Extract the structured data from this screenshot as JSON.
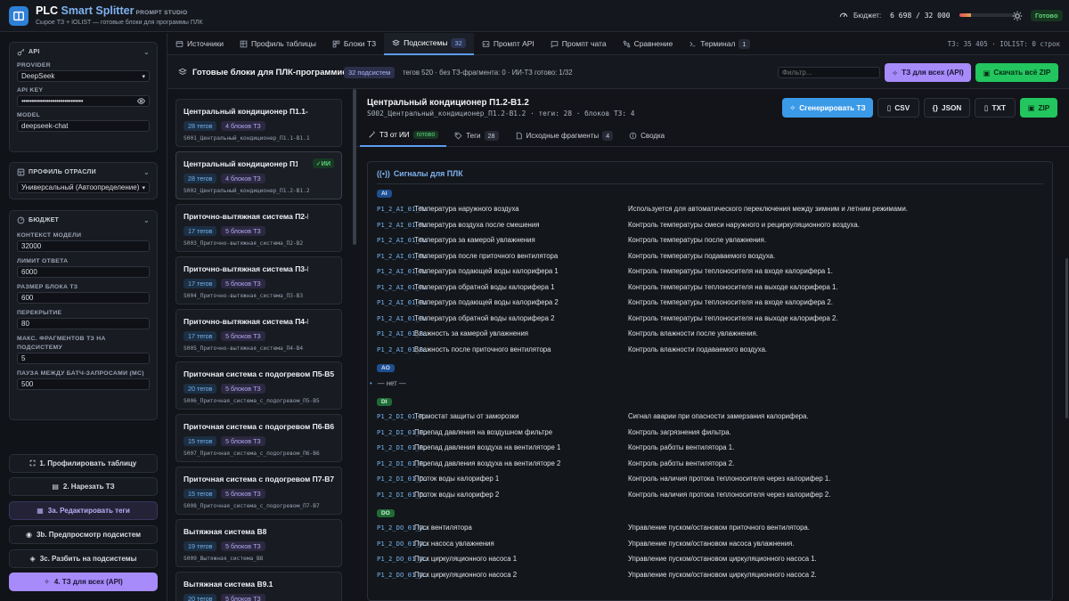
{
  "app": {
    "title_part1": "PLC ",
    "title_part2": "Smart Splitter",
    "studio": "PROMPT STUDIO",
    "subtitle": "Сырое ТЗ + IOLIST — готовые блоки для программы ПЛК",
    "budget_label": "Бюджет:",
    "budget_value": "6 698 / 32 000",
    "budget_fraction": 0.209,
    "status": "Готово"
  },
  "sidebar": {
    "api": {
      "header": "API",
      "provider_label": "PROVIDER",
      "provider_value": "DeepSeek",
      "apikey_label": "API KEY",
      "apikey_value": "••••••••••••••••••••••••••••••",
      "model_label": "MODEL",
      "model_value": "deepseek-chat"
    },
    "industry": {
      "header": "ПРОФИЛЬ ОТРАСЛИ",
      "value": "Универсальный (Автоопределение)"
    },
    "budget": {
      "header": "БЮДЖЕТ",
      "fields": [
        {
          "label": "КОНТЕКСТ МОДЕЛИ",
          "value": "32000"
        },
        {
          "label": "ЛИМИТ ОТВЕТА",
          "value": "6000"
        },
        {
          "label": "РАЗМЕР БЛОКА ТЗ",
          "value": "600"
        },
        {
          "label": "ПЕРЕКРЫТИЕ",
          "value": "80"
        },
        {
          "label": "МАКС. ФРАГМЕНТОВ ТЗ НА",
          "label2": "ПОДСИСТЕМУ",
          "value": "5"
        },
        {
          "label": "ПАУЗА МЕЖДУ БАТЧ-ЗАПРОСАМИ (МС)",
          "value": "500"
        }
      ]
    },
    "buttons": [
      {
        "label": "1. Профилировать таблицу",
        "icon": "scan-icon"
      },
      {
        "label": "2. Нарезать ТЗ",
        "icon": "table-icon"
      },
      {
        "label": "3a. Редактировать теги",
        "icon": "edit-table-icon"
      },
      {
        "label": "3b. Предпросмотр подсистем",
        "icon": "eye-icon"
      },
      {
        "label": "3c. Разбить на подсистемы",
        "icon": "layers-icon"
      },
      {
        "label": "4. ТЗ для всех (API)",
        "icon": "sparkle-icon"
      }
    ]
  },
  "tabs": [
    {
      "label": "Источники",
      "icon": "folder-icon"
    },
    {
      "label": "Профиль таблицы",
      "icon": "grid-icon"
    },
    {
      "label": "Блоки ТЗ",
      "icon": "blocks-icon"
    },
    {
      "label": "Подсистемы",
      "icon": "layers-icon",
      "count": "32"
    },
    {
      "label": "Промпт API",
      "icon": "code-icon"
    },
    {
      "label": "Промпт чата",
      "icon": "chat-icon"
    },
    {
      "label": "Сравнение",
      "icon": "compare-icon"
    },
    {
      "label": "Терминал",
      "icon": "terminal-icon",
      "count": "1"
    }
  ],
  "tabs_right": "ТЗ: 35 405 · IOLIST: 0 строк",
  "header": {
    "title": "Готовые блоки для ПЛК-программиста",
    "badge": "32 подсистем",
    "meta": "тегов 520 · без ТЗ-фрагмента: 0 · ИИ-ТЗ готово: 1/32",
    "filter_placeholder": "Фильтр...",
    "btn_api": "ТЗ для всех (API)",
    "btn_zip": "Скачать всё ZIP"
  },
  "subsystems": [
    {
      "name": "Центральный кондиционер П1.1-В1.1",
      "tags": "28 тегов",
      "blocks": "4 блоков ТЗ",
      "file": "S001_Центральный_кондиционер_П1.1-В1.1"
    },
    {
      "name": "Центральный кондиционер П1.2-В1.2",
      "ai": "✓ИИ",
      "tags": "28 тегов",
      "blocks": "4 блоков ТЗ",
      "file": "S002_Центральный_кондиционер_П1.2-В1.2"
    },
    {
      "name": "Приточно-вытяжная система П2-В2",
      "tags": "17 тегов",
      "blocks": "5 блоков ТЗ",
      "file": "S003_Приточно-вытяжная_система_П2-В2"
    },
    {
      "name": "Приточно-вытяжная система П3-В3",
      "tags": "17 тегов",
      "blocks": "5 блоков ТЗ",
      "file": "S004_Приточно-вытяжная_система_П3-В3"
    },
    {
      "name": "Приточно-вытяжная система П4-В4",
      "tags": "17 тегов",
      "blocks": "5 блоков ТЗ",
      "file": "S005_Приточно-вытяжная_система_П4-В4"
    },
    {
      "name": "Приточная система с подогревом П5-В5",
      "tags": "20 тегов",
      "blocks": "5 блоков ТЗ",
      "file": "S006_Приточная_система_с_подогревом_П5-В5"
    },
    {
      "name": "Приточная система с подогревом П6-В6",
      "tags": "15 тегов",
      "blocks": "5 блоков ТЗ",
      "file": "S007_Приточная_система_с_подогревом_П6-В6"
    },
    {
      "name": "Приточная система с подогревом П7-В7",
      "tags": "15 тегов",
      "blocks": "5 блоков ТЗ",
      "file": "S008_Приточная_система_с_подогревом_П7-В7"
    },
    {
      "name": "Вытяжная система В8",
      "tags": "19 тегов",
      "blocks": "5 блоков ТЗ",
      "file": "S009_Вытяжная_система_В8"
    },
    {
      "name": "Вытяжная система В9.1",
      "tags": "20 тегов",
      "blocks": "5 блоков ТЗ",
      "file": ""
    }
  ],
  "detail": {
    "title": "Центральный кондиционер П1.2-В1.2",
    "sub": "S002_Центральный_кондиционер_П1.2-В1.2 · теги: 28 · блоков ТЗ: 4",
    "btn_generate": "Сгенерировать ТЗ",
    "btn_csv": "CSV",
    "btn_json": "JSON",
    "btn_txt": "TXT",
    "btn_zip": "ZIP",
    "tabs": [
      {
        "label": "ТЗ от ИИ",
        "badge": "готово"
      },
      {
        "label": "Теги",
        "count": "28"
      },
      {
        "label": "Исходные фрагменты",
        "count": "4"
      },
      {
        "label": "Сводка"
      }
    ],
    "section_title": "Сигналы для ПЛК",
    "none_text": "— нет —",
    "groups": {
      "ai": "AI",
      "ao": "AO",
      "di": "DI",
      "do": "DO"
    },
    "ai_rows": [
      {
        "code": "P1_2_AI_01_T…",
        "sig": "Температура наружного воздуха",
        "desc": "Используется для автоматического переключения между зимним и летним режимами."
      },
      {
        "code": "P1_2_AI_01_T…",
        "sig": "Температура воздуха после смешения",
        "desc": "Контроль температуры смеси наружного и рециркуляционного воздуха."
      },
      {
        "code": "P1_2_AI_01_T…",
        "sig": "Температура за камерой увлажнения",
        "desc": "Контроль температуры после увлажнения."
      },
      {
        "code": "P1_2_AI_01_T…",
        "sig": "Температура после приточного вентилятора",
        "desc": "Контроль температуры подаваемого воздуха."
      },
      {
        "code": "P1_2_AI_01_T…",
        "sig": "Температура подающей воды калорифера 1",
        "desc": "Контроль температуры теплоносителя на входе калорифера 1."
      },
      {
        "code": "P1_2_AI_01_T…",
        "sig": "Температура обратной воды калорифера 1",
        "desc": "Контроль температуры теплоносителя на выходе калорифера 1."
      },
      {
        "code": "P1_2_AI_01_T…",
        "sig": "Температура подающей воды калорифера 2",
        "desc": "Контроль температуры теплоносителя на входе калорифера 2."
      },
      {
        "code": "P1_2_AI_01_T…",
        "sig": "Температура обратной воды калорифера 2",
        "desc": "Контроль температуры теплоносителя на выходе калорифера 2."
      },
      {
        "code": "P1_2_AI_01_B…",
        "sig": "Влажность за камерой увлажнения",
        "desc": "Контроль влажности после увлажнения."
      },
      {
        "code": "P1_2_AI_01_B…",
        "sig": "Влажность после приточного вентилятора",
        "desc": "Контроль влажности подаваемого воздуха."
      }
    ],
    "di_rows": [
      {
        "code": "P1_2_DI_01_T…",
        "sig": "Термостат защиты от заморозки",
        "desc": "Сигнал аварии при опасности замерзания калорифера."
      },
      {
        "code": "P1_2_DI_01_П…",
        "sig": "Перепад давления на воздушном фильтре",
        "desc": "Контроль загрязнения фильтра."
      },
      {
        "code": "P1_2_DI_01_П…",
        "sig": "Перепад давления воздуха на вентиляторе 1",
        "desc": "Контроль работы вентилятора 1."
      },
      {
        "code": "P1_2_DI_01_П…",
        "sig": "Перепад давления воздуха на вентиляторе 2",
        "desc": "Контроль работы вентилятора 2."
      },
      {
        "code": "P1_2_DI_01_П…",
        "sig": "Проток воды калорифер 1",
        "desc": "Контроль наличия протока теплоносителя через калорифер 1."
      },
      {
        "code": "P1_2_DI_01_П…",
        "sig": "Проток воды калорифер 2",
        "desc": "Контроль наличия протока теплоносителя через калорифер 2."
      }
    ],
    "do_rows": [
      {
        "code": "P1_2_DO_01_П…",
        "sig": "Пуск вентилятора",
        "desc": "Управление пуском/остановом приточного вентилятора."
      },
      {
        "code": "P1_2_DO_01_П…",
        "sig": "Пуск насоса увлажнения",
        "desc": "Управление пуском/остановом насоса увлажнения."
      },
      {
        "code": "P1_2_DO_01_П…",
        "sig": "Пуск циркуляционного насоса 1",
        "desc": "Управление пуском/остановом циркуляционного насоса 1."
      },
      {
        "code": "P1_2_DO_01_П…",
        "sig": "Пуск циркуляционного насоса 2",
        "desc": "Управление пуском/остановом циркуляционного насоса 2."
      }
    ]
  }
}
